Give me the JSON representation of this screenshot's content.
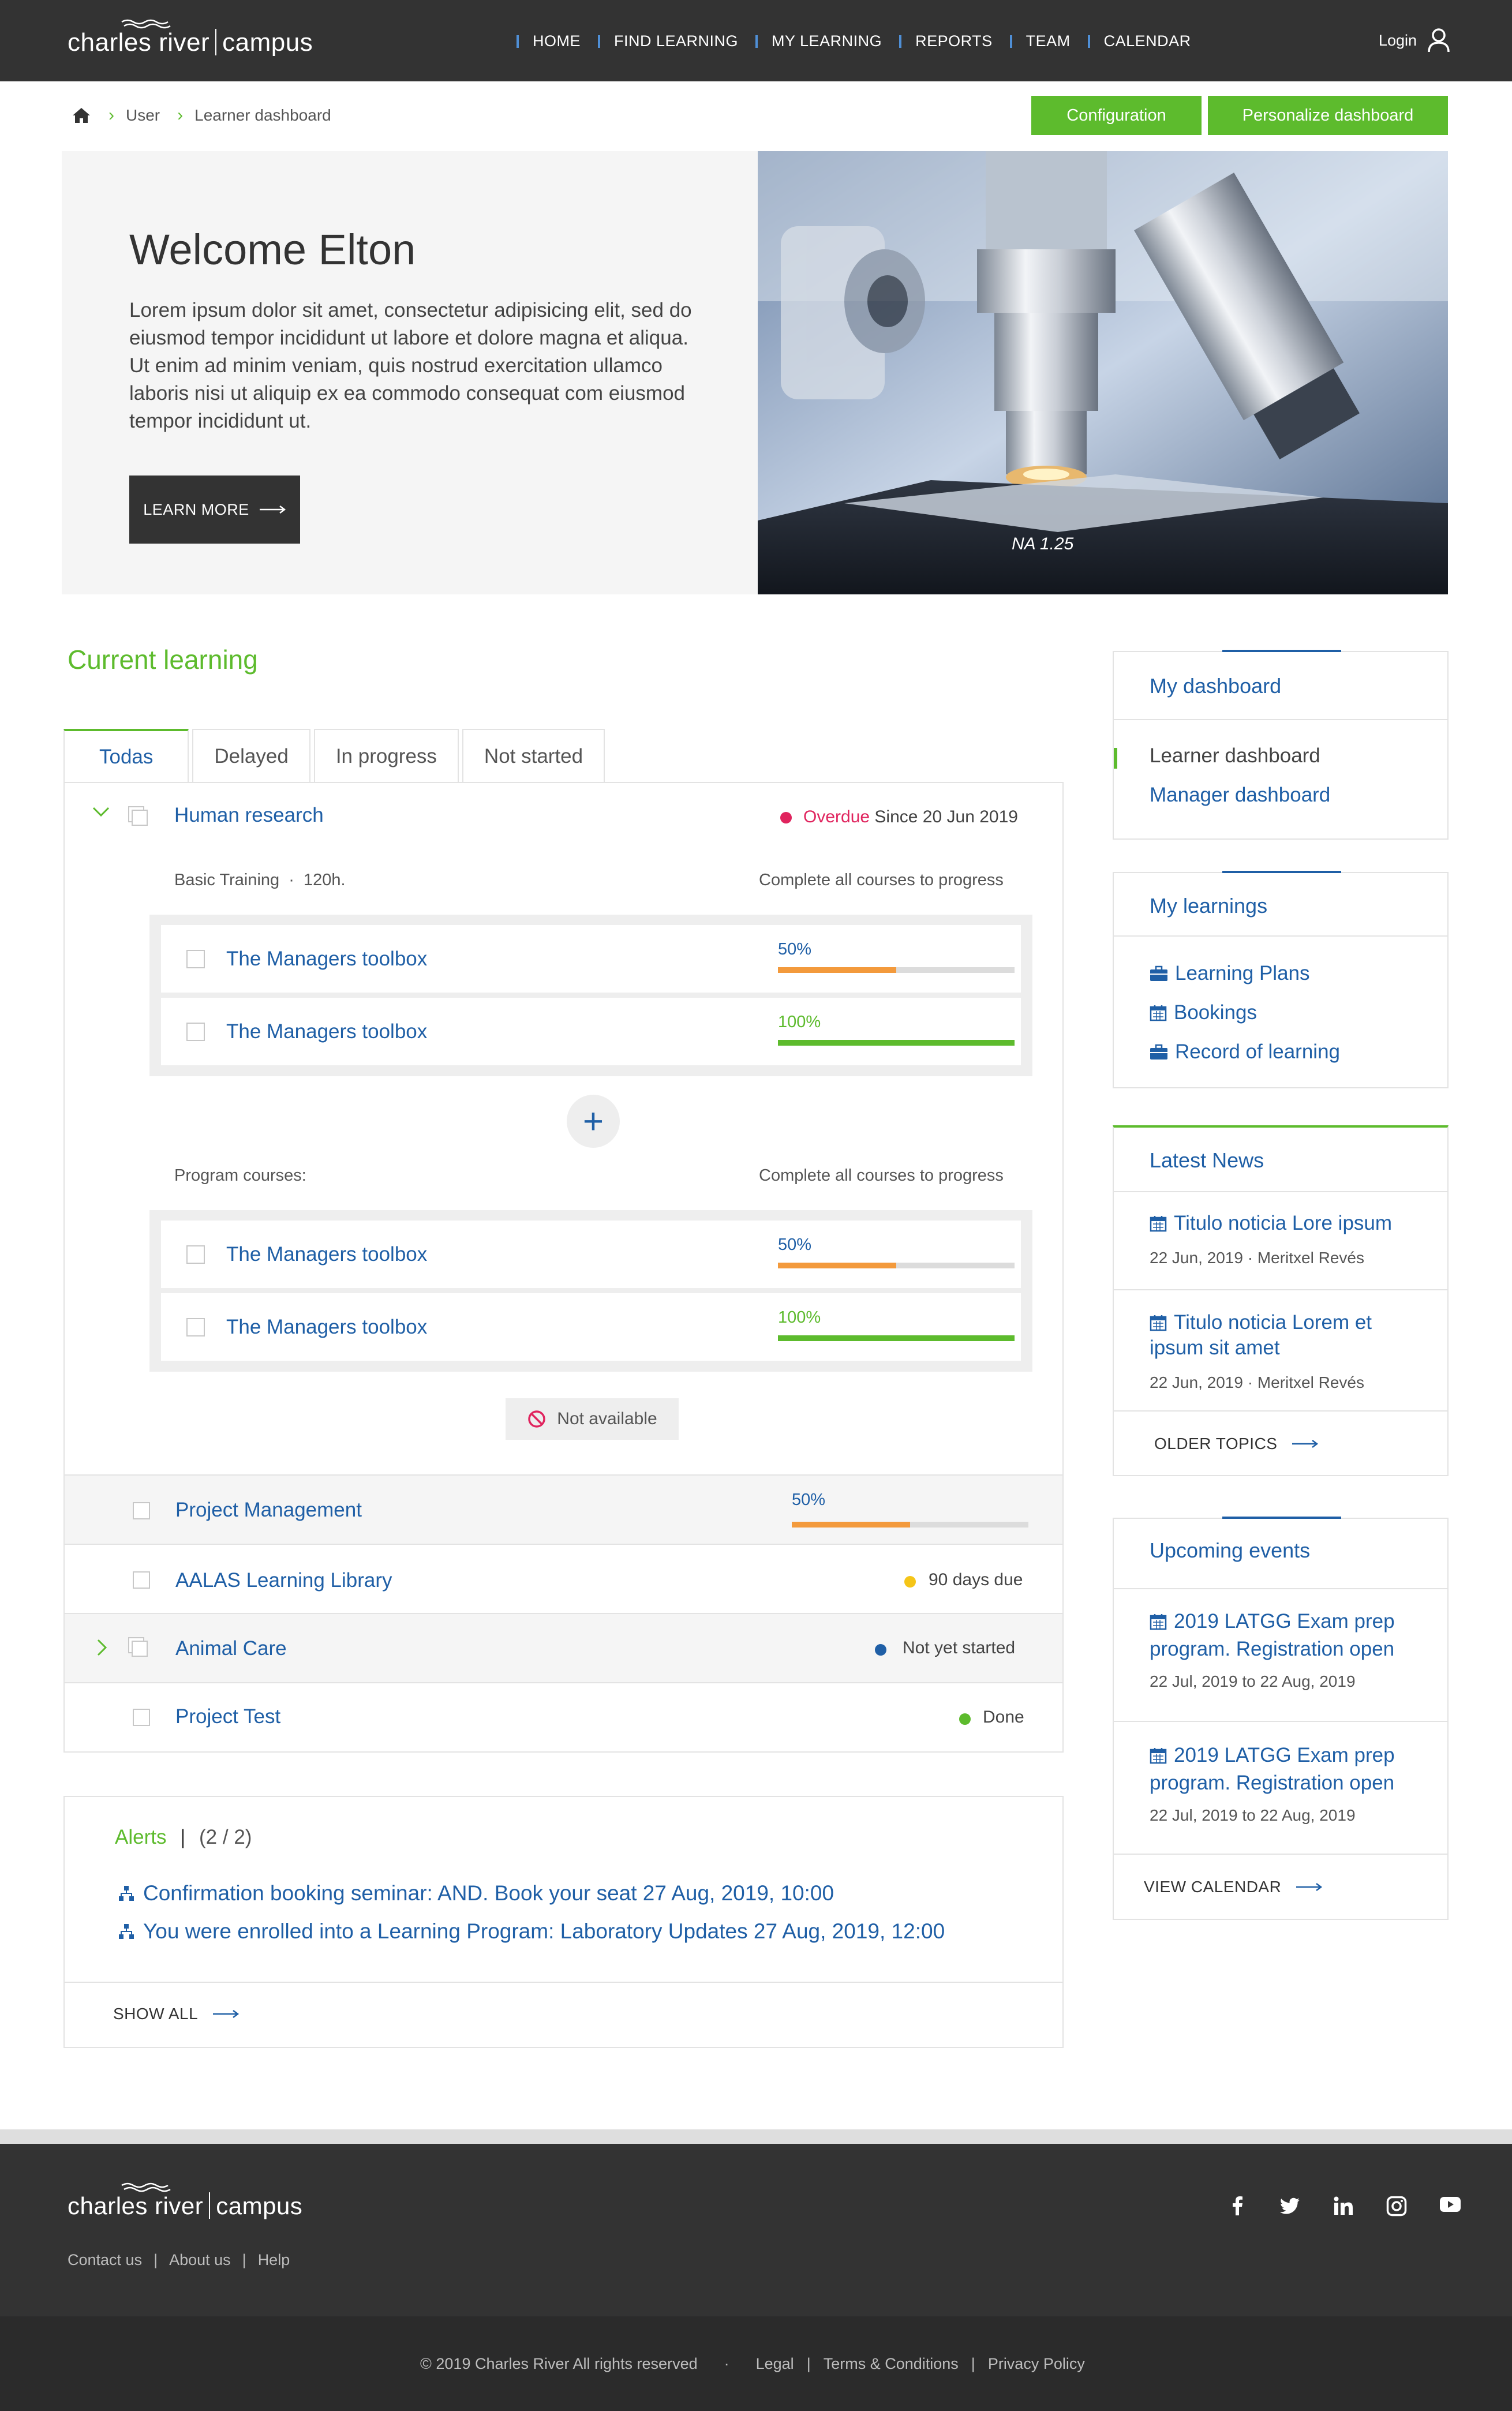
{
  "brand": {
    "left": "charles river",
    "right": "campus"
  },
  "nav": {
    "items": [
      "HOME",
      "FIND LEARNING",
      "MY LEARNING",
      "REPORTS",
      "TEAM",
      "CALENDAR"
    ],
    "login": "Login"
  },
  "breadcrumb": {
    "items": [
      "User",
      "Learner dashboard"
    ]
  },
  "actions": {
    "configuration": "Configuration",
    "personalize": "Personalize dashboard"
  },
  "hero": {
    "title": "Welcome Elton",
    "text": "Lorem ipsum dolor sit amet, consectetur adipisicing elit, sed do eiusmod tempor incididunt ut labore et dolore magna et aliqua. Ut enim ad minim veniam, quis nostrud exercitation ullamco laboris nisi ut aliquip ex ea commodo consequat com eiusmod tempor incididunt ut.",
    "button": "LEARN MORE",
    "image_label": "NA 1.25"
  },
  "current_learning": {
    "title": "Current learning",
    "tabs": [
      "Todas",
      "Delayed",
      "In progress",
      "Not started"
    ],
    "plan": {
      "name": "Human research",
      "status_word": "Overdue",
      "status_rest": "Since 20 Jun 2019",
      "basic_label": "Basic Training",
      "basic_hours": "120h.",
      "complete_note": "Complete all courses to progress",
      "courses_a": [
        {
          "name": "The Managers toolbox",
          "progress": "50%",
          "value": 0.5
        },
        {
          "name": "The Managers toolbox",
          "progress": "100%",
          "value": 1.0
        }
      ],
      "program_label": "Program courses:",
      "courses_b": [
        {
          "name": "The Managers toolbox",
          "progress": "50%",
          "value": 0.5
        },
        {
          "name": "The Managers toolbox",
          "progress": "100%",
          "value": 1.0
        }
      ],
      "not_available": "Not available"
    },
    "rows": [
      {
        "name": "Project Management",
        "progress": "50%",
        "value": 0.5
      },
      {
        "name": "AALAS Learning Library",
        "status": "90 days due"
      },
      {
        "name": "Animal Care",
        "status": "Not yet started"
      },
      {
        "name": "Project Test",
        "status": "Done"
      }
    ]
  },
  "alerts": {
    "title": "Alerts",
    "count": "(2 / 2)",
    "items": [
      "Confirmation booking seminar: AND. Book your seat 27 Aug, 2019, 10:00",
      "You were enrolled into a Learning Program: Laboratory Updates 27 Aug, 2019, 12:00"
    ],
    "show_all": "SHOW ALL"
  },
  "my_dashboard": {
    "title": "My dashboard",
    "items": [
      "Learner dashboard",
      "Manager dashboard"
    ]
  },
  "my_learnings": {
    "title": "My learnings",
    "items": [
      "Learning Plans",
      "Bookings",
      "Record of learning"
    ]
  },
  "latest_news": {
    "title": "Latest News",
    "items": [
      {
        "title": "Titulo noticia Lore ipsum",
        "meta": "22 Jun, 2019 · Meritxel Revés"
      },
      {
        "title_1": "Titulo noticia Lorem et",
        "title_2": "ipsum sit amet",
        "meta": "22 Jun, 2019 · Meritxel Revés"
      }
    ],
    "older": "OLDER TOPICS"
  },
  "upcoming_events": {
    "title": "Upcoming events",
    "items": [
      {
        "title_1": "2019 LATGG Exam prep",
        "title_2": "program. Registration open",
        "meta": "22 Jul, 2019  to  22 Aug, 2019"
      },
      {
        "title_1": "2019 LATGG Exam prep",
        "title_2": "program. Registration open",
        "meta": "22 Jul, 2019  to  22 Aug, 2019"
      }
    ],
    "view": "VIEW CALENDAR"
  },
  "footer": {
    "links": [
      "Contact us",
      "About us",
      "Help"
    ],
    "copyright": "© 2019 Charles River All rights reserved",
    "legal": [
      "Legal",
      "Terms & Conditions",
      "Privacy Policy"
    ],
    "social": [
      "facebook-icon",
      "twitter-icon",
      "linkedin-icon",
      "instagram-icon",
      "youtube-icon"
    ]
  },
  "colors": {
    "green": "#5dbb2d",
    "blue": "#1f5fa6",
    "orange": "#f39a3c",
    "red": "#e0245e",
    "yellow": "#f5c518",
    "dark": "#333333"
  }
}
